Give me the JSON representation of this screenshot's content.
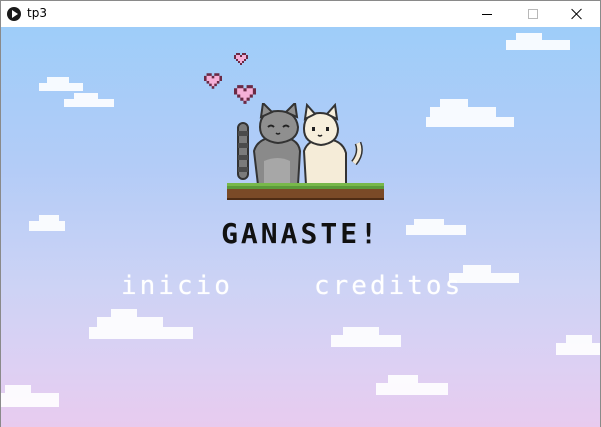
{
  "window": {
    "title": "tp3",
    "icon": "processing-play-icon"
  },
  "game": {
    "heading": "GANASTE!",
    "menu": {
      "start_label": "inicio",
      "credits_label": "creditos"
    },
    "scene": {
      "characters": [
        "gray-cat",
        "cream-cat"
      ],
      "decorations": [
        "heart",
        "heart",
        "heart"
      ]
    }
  },
  "colors": {
    "sky_top": "#9ecdf9",
    "sky_bottom": "#e8cbef",
    "heading": "#111111",
    "menu_text": "#ffffff",
    "heart": "#f6b0d8",
    "grass": "#5b9a3a",
    "dirt": "#7a4a27"
  }
}
